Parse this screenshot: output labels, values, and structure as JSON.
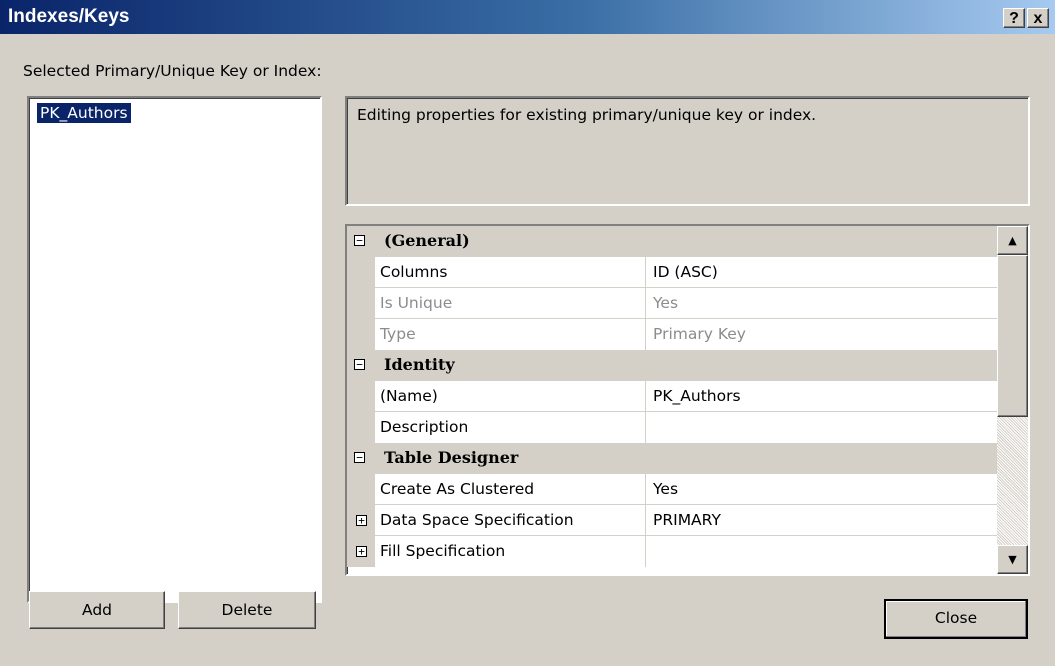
{
  "window": {
    "title": "Indexes/Keys",
    "help_label": "?",
    "close_label": "x"
  },
  "selector": {
    "label": "Selected Primary/Unique Key or Index:",
    "items": [
      "PK_Authors"
    ]
  },
  "description": "Editing properties for existing primary/unique key or index.",
  "properties": {
    "categories": [
      {
        "label": "(General)",
        "expanded": true,
        "rows": [
          {
            "name": "Columns",
            "value": "ID (ASC)",
            "readonly": false
          },
          {
            "name": "Is Unique",
            "value": "Yes",
            "readonly": true
          },
          {
            "name": "Type",
            "value": "Primary Key",
            "readonly": true
          }
        ]
      },
      {
        "label": "Identity",
        "expanded": true,
        "rows": [
          {
            "name": "(Name)",
            "value": "PK_Authors",
            "readonly": false
          },
          {
            "name": "Description",
            "value": "",
            "readonly": false
          }
        ]
      },
      {
        "label": "Table Designer",
        "expanded": true,
        "rows": [
          {
            "name": "Create As Clustered",
            "value": "Yes",
            "readonly": false
          },
          {
            "name": "Data Space Specification",
            "value": "PRIMARY",
            "readonly": false,
            "expandable": true
          },
          {
            "name": "Fill Specification",
            "value": "",
            "readonly": false,
            "expandable": true
          }
        ]
      }
    ],
    "collapse_glyph": "⊟",
    "expand_glyph": "⊞"
  },
  "buttons": {
    "add": "Add",
    "delete": "Delete",
    "close": "Close"
  },
  "scrollbar": {
    "up_icon": "▲",
    "down_icon": "▼"
  }
}
